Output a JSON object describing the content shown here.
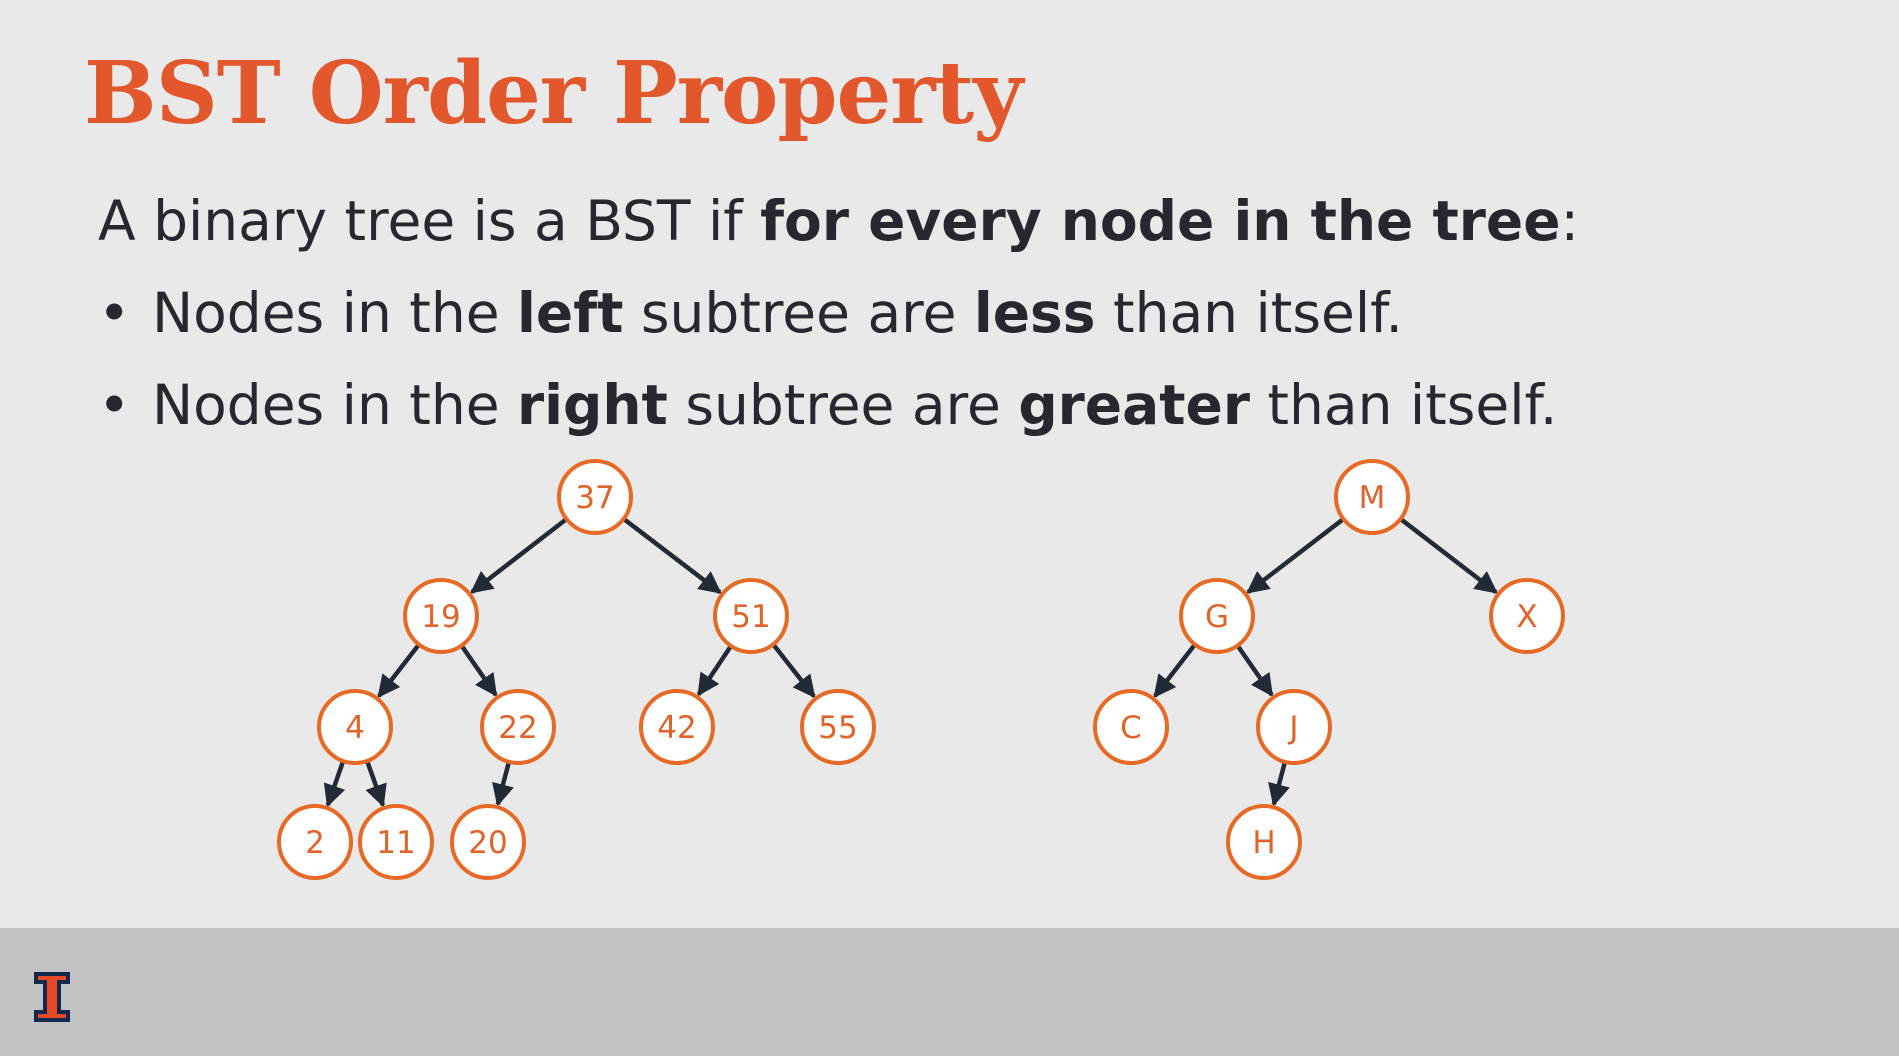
{
  "slide": {
    "title": "BST Order Property",
    "intro": {
      "part1": "A binary tree is a BST if ",
      "bold": "for every node in the tree",
      "part2": ":"
    },
    "bullets": [
      {
        "bullet": "•",
        "a": "Nodes in the ",
        "b1": "left",
        "c": " subtree are ",
        "b2": "less",
        "d": " than itself."
      },
      {
        "bullet": "•",
        "a": "Nodes in the ",
        "b1": "right",
        "c": " subtree are ",
        "b2": "greater",
        "d": " than itself."
      }
    ]
  },
  "colors": {
    "accent": "#e2572b",
    "node_stroke": "#e66a26",
    "node_text": "#e0642a",
    "node_fill": "#ffffff",
    "edge": "#222a36",
    "text": "#27272f",
    "background": "#e9e9e9",
    "footer": "#c2c2c3"
  },
  "footer": {
    "logo_icon": "illinois-block-i-logo"
  },
  "trees": [
    {
      "name": "numeric-bst",
      "nodes": [
        {
          "id": "37",
          "label": "37"
        },
        {
          "id": "19",
          "label": "19"
        },
        {
          "id": "51",
          "label": "51"
        },
        {
          "id": "4",
          "label": "4"
        },
        {
          "id": "22",
          "label": "22"
        },
        {
          "id": "42",
          "label": "42"
        },
        {
          "id": "55",
          "label": "55"
        },
        {
          "id": "2",
          "label": "2"
        },
        {
          "id": "11",
          "label": "11"
        },
        {
          "id": "20",
          "label": "20"
        }
      ],
      "edges": [
        [
          "37",
          "19"
        ],
        [
          "37",
          "51"
        ],
        [
          "19",
          "4"
        ],
        [
          "19",
          "22"
        ],
        [
          "51",
          "42"
        ],
        [
          "51",
          "55"
        ],
        [
          "4",
          "2"
        ],
        [
          "4",
          "11"
        ],
        [
          "22",
          "20"
        ]
      ]
    },
    {
      "name": "letter-bst",
      "nodes": [
        {
          "id": "M",
          "label": "M"
        },
        {
          "id": "G",
          "label": "G"
        },
        {
          "id": "X",
          "label": "X"
        },
        {
          "id": "C",
          "label": "C"
        },
        {
          "id": "J",
          "label": "J"
        },
        {
          "id": "H",
          "label": "H"
        }
      ],
      "edges": [
        [
          "M",
          "G"
        ],
        [
          "M",
          "X"
        ],
        [
          "G",
          "C"
        ],
        [
          "G",
          "J"
        ],
        [
          "J",
          "H"
        ]
      ]
    }
  ]
}
